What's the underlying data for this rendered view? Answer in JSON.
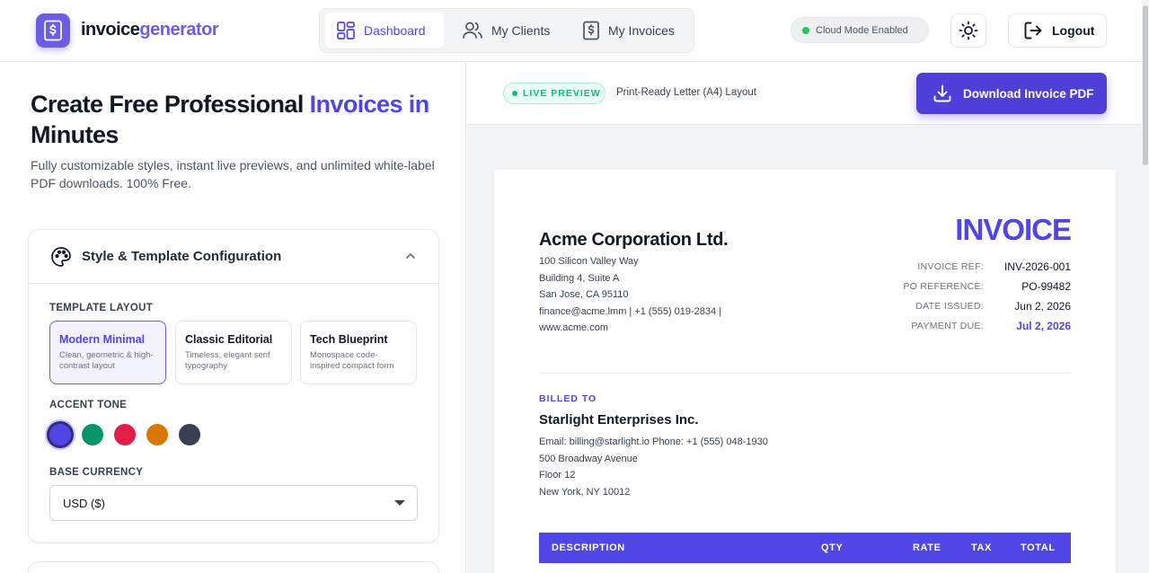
{
  "header": {
    "logo_part1": "invoice",
    "logo_part2": "generator",
    "nav": [
      {
        "label": "Dashboard",
        "icon": "dashboard-icon",
        "active": true
      },
      {
        "label": "My Clients",
        "icon": "users-icon",
        "active": false
      },
      {
        "label": "My Invoices",
        "icon": "invoice-icon",
        "active": false
      }
    ],
    "cloud_status": "Cloud Mode Enabled",
    "logout_label": "Logout",
    "accent_color": "#4f46e5"
  },
  "hero": {
    "title_part1": "Create Free Professional ",
    "title_accent": "Invoices in",
    "title_part2": "Minutes",
    "subtitle": "Fully customizable styles, instant live previews, and unlimited white-label PDF downloads. 100% Free."
  },
  "config": {
    "title": "Style & Template Configuration",
    "template_label": "TEMPLATE LAYOUT",
    "templates": [
      {
        "name": "Modern Minimal",
        "desc": "Clean, geometric & high-contrast layout",
        "active": true
      },
      {
        "name": "Classic Editorial",
        "desc": "Timeless, elegant serif typography",
        "active": false
      },
      {
        "name": "Tech Blueprint",
        "desc": "Monospace code-inspired compact form",
        "active": false
      }
    ],
    "accent_label": "ACCENT TONE",
    "accent_colors": [
      "#4f46e5",
      "#059669",
      "#e11d48",
      "#d97706",
      "#374151"
    ],
    "currency_label": "BASE CURRENCY",
    "currency_value": "USD ($)"
  },
  "preview": {
    "live_label": "LIVE PREVIEW",
    "layout_note": "Print-Ready Letter (A4) Layout",
    "download_label": "Download Invoice PDF"
  },
  "invoice": {
    "company": "Acme Corporation Ltd.",
    "address_lines": [
      "100 Silicon Valley Way",
      "Building 4, Suite A",
      "San Jose, CA 95110",
      "finance@acme.lmm | +1 (555) 019-2834 |",
      "www.acme.com"
    ],
    "title": "INVOICE",
    "meta": [
      {
        "key": "INVOICE REF:",
        "value": "INV-2026-001"
      },
      {
        "key": "PO REFERENCE:",
        "value": "PO-99482"
      },
      {
        "key": "DATE ISSUED:",
        "value": "Jun 2, 2026"
      },
      {
        "key": "PAYMENT DUE:",
        "value": "Jul 2, 2026"
      }
    ],
    "billed_to_label": "BILLED TO",
    "client_name": "Starlight Enterprises Inc.",
    "client_lines": [
      "Email: billing@starlight.io Phone: +1 (555) 048-1930",
      "500 Broadway Avenue",
      "Floor 12",
      "New York, NY 10012"
    ],
    "table_headers": [
      "DESCRIPTION",
      "QTY",
      "RATE",
      "TAX",
      "TOTAL"
    ]
  }
}
